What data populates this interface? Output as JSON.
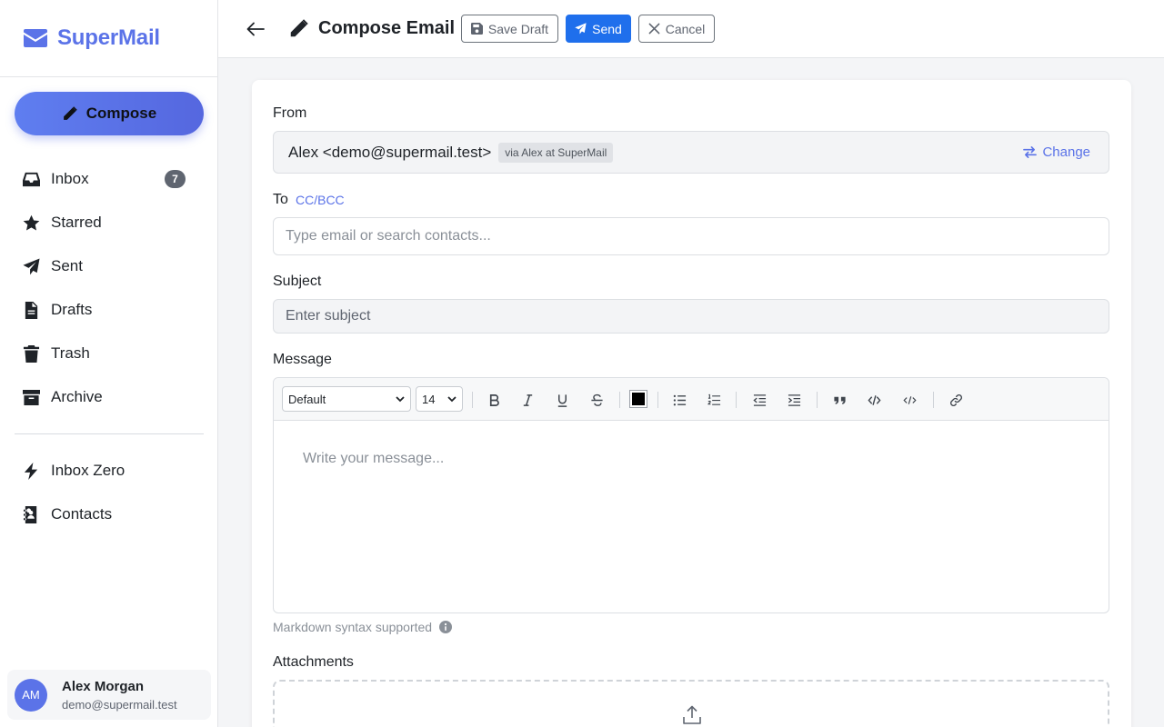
{
  "app": {
    "name": "SuperMail"
  },
  "sidebar": {
    "compose_label": "Compose",
    "items": [
      {
        "label": "Inbox",
        "icon": "inbox-icon",
        "badge": "7"
      },
      {
        "label": "Starred",
        "icon": "star-icon"
      },
      {
        "label": "Sent",
        "icon": "send-icon"
      },
      {
        "label": "Drafts",
        "icon": "file-icon"
      },
      {
        "label": "Trash",
        "icon": "trash-icon"
      },
      {
        "label": "Archive",
        "icon": "archive-icon"
      }
    ],
    "secondary_items": [
      {
        "label": "Inbox Zero",
        "icon": "bolt-icon"
      },
      {
        "label": "Contacts",
        "icon": "address-book-icon"
      }
    ],
    "user": {
      "initials": "AM",
      "name": "Alex Morgan",
      "email": "demo@supermail.test"
    }
  },
  "header": {
    "title": "Compose Email",
    "save_draft_label": "Save Draft",
    "send_label": "Send",
    "cancel_label": "Cancel"
  },
  "form": {
    "from_label": "From",
    "from_value": "Alex <demo@supermail.test>",
    "from_via": "via Alex at SuperMail",
    "change_label": "Change",
    "to_label": "To",
    "ccbcc_label": "CC/BCC",
    "to_placeholder": "Type email or search contacts...",
    "subject_label": "Subject",
    "subject_placeholder": "Enter subject",
    "message_label": "Message",
    "font_family": "Default",
    "font_size": "14",
    "text_color": "#000000",
    "message_placeholder": "Write your message...",
    "markdown_hint": "Markdown syntax supported",
    "attachments_label": "Attachments"
  },
  "colors": {
    "accent": "#5b73e8",
    "send": "#1f6fec"
  }
}
